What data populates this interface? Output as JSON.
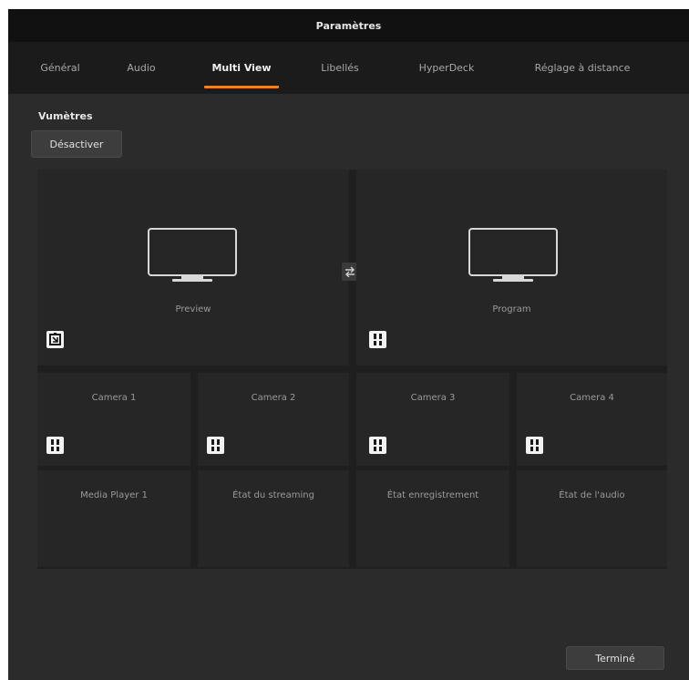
{
  "dialog": {
    "title": "Paramètres",
    "tabs": [
      {
        "label": "Général",
        "active": false
      },
      {
        "label": "Audio",
        "active": false
      },
      {
        "label": "Multi View",
        "active": true
      },
      {
        "label": "Libellés",
        "active": false
      },
      {
        "label": "HyperDeck",
        "active": false
      },
      {
        "label": "Réglage à distance",
        "active": false
      }
    ],
    "accent_color": "#e8852a"
  },
  "multiview": {
    "section_title": "Vumètres",
    "toggle_button": "Désactiver",
    "large_views": [
      {
        "label": "Preview",
        "icon": "expand-icon"
      },
      {
        "label": "Program",
        "icon": "audio-meter-icon"
      }
    ],
    "swap_icon": "swap-icon",
    "camera_row": [
      {
        "label": "Camera 1",
        "icon": "audio-meter-icon"
      },
      {
        "label": "Camera 2",
        "icon": "audio-meter-icon"
      },
      {
        "label": "Camera 3",
        "icon": "audio-meter-icon"
      },
      {
        "label": "Camera 4",
        "icon": "audio-meter-icon"
      }
    ],
    "status_row": [
      {
        "label": "Media Player 1"
      },
      {
        "label": "État du streaming"
      },
      {
        "label": "État enregistrement"
      },
      {
        "label": "État de l'audio"
      }
    ]
  },
  "footer": {
    "done_button": "Terminé"
  }
}
